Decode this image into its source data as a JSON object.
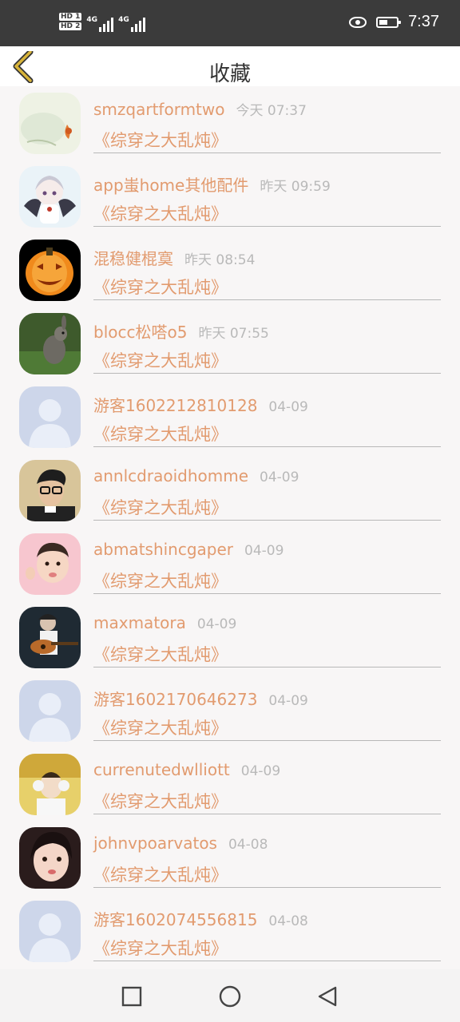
{
  "status_bar": {
    "time": "7:37",
    "sim1_label": "HD 1",
    "sim2_label": "HD 2",
    "network1": "4G",
    "network2": "4G",
    "icons": [
      "hd-icon",
      "signal-icon",
      "eye-icon",
      "battery-icon"
    ]
  },
  "header": {
    "title": "收藏",
    "back_icon": "chevron-left-icon",
    "accent": "#d8b43a"
  },
  "colors": {
    "accent_text": "#e29b6f",
    "time_text": "#b9b9b9"
  },
  "favorites": [
    {
      "name": "smzqartformtwo",
      "time": "今天 07:37",
      "book": "《综穿之大乱炖》",
      "avatar": "goldfish-painting"
    },
    {
      "name": "app蚩home其他配件",
      "time": "昨天 09:59",
      "book": "《综穿之大乱炖》",
      "avatar": "anime-character"
    },
    {
      "name": "混稳健棍寞",
      "time": "昨天 08:54",
      "book": "《综穿之大乱炖》",
      "avatar": "jack-o-lantern"
    },
    {
      "name": "blocc松嗒o5",
      "time": "昨天 07:55",
      "book": "《综穿之大乱炖》",
      "avatar": "rabbit-photo"
    },
    {
      "name": "游客1602212810128",
      "time": "04-09",
      "book": "《综穿之大乱炖》",
      "avatar": "default-user"
    },
    {
      "name": "annlcdraoidhomme",
      "time": "04-09",
      "book": "《综穿之大乱炖》",
      "avatar": "man-glasses-photo"
    },
    {
      "name": "abmatshincgaper",
      "time": "04-09",
      "book": "《综穿之大乱炖》",
      "avatar": "baby-photo"
    },
    {
      "name": "maxmatora",
      "time": "04-09",
      "book": "《综穿之大乱炖》",
      "avatar": "guitarist-photo"
    },
    {
      "name": "游客1602170646273",
      "time": "04-09",
      "book": "《综穿之大乱炖》",
      "avatar": "default-user"
    },
    {
      "name": "currenutedwlliott",
      "time": "04-09",
      "book": "《综穿之大乱炖》",
      "avatar": "girl-earmuffs-photo"
    },
    {
      "name": "johnvpoarvatos",
      "time": "04-08",
      "book": "《综穿之大乱炖》",
      "avatar": "girl-portrait-photo"
    },
    {
      "name": "游客1602074556815",
      "time": "04-08",
      "book": "《综穿之大乱炖》",
      "avatar": "default-user"
    }
  ],
  "nav_bar": {
    "buttons": [
      "recents-square-icon",
      "home-circle-icon",
      "back-triangle-icon"
    ]
  }
}
